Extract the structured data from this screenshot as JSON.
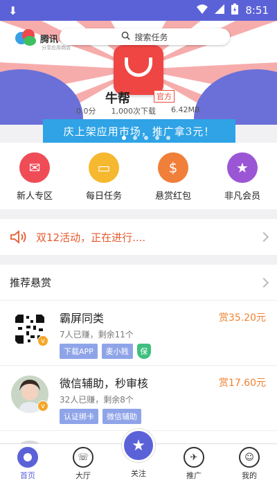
{
  "status_bar": {
    "time": "8:51"
  },
  "header": {
    "logo_name": "腾讯",
    "logo_sub": "分享应用商店",
    "search_placeholder": "搜索任务"
  },
  "banner": {
    "app_name": "牛帮",
    "official_badge": "官方",
    "score": "0.0分",
    "downloads": "1,000次下载",
    "size": "6.42MB",
    "promo_text": "庆上架应用市场，推广拿3元！"
  },
  "quick_nav": [
    {
      "label": "新人专区",
      "icon": "red-envelope-icon"
    },
    {
      "label": "每日任务",
      "icon": "laptop-icon"
    },
    {
      "label": "悬赏红包",
      "icon": "money-bag-icon"
    },
    {
      "label": "非凡会员",
      "icon": "vip-coin-icon"
    }
  ],
  "notice": {
    "text": "双12活动，正在进行...."
  },
  "recommended": {
    "title": "推荐悬赏",
    "tasks": [
      {
        "title": "霸屏同类",
        "sub": "7人已赚，剩余11个",
        "reward": "赏35.20元",
        "tags": [
          "下载APP",
          "麦小贱"
        ],
        "shield": "保"
      },
      {
        "title": "微信辅助，秒审核",
        "sub": "32人已赚，剩余8个",
        "reward": "赏17.60元",
        "tags": [
          "认证绑卡",
          "微信辅助"
        ]
      }
    ]
  },
  "tabs": [
    {
      "label": "首页"
    },
    {
      "label": "大厅"
    },
    {
      "label": "关注"
    },
    {
      "label": "推广"
    },
    {
      "label": "我的"
    }
  ],
  "colors": {
    "primary": "#5b62d8",
    "reward": "#f0822f",
    "notice": "#e65b2e",
    "promo": "#2fa3e6"
  }
}
